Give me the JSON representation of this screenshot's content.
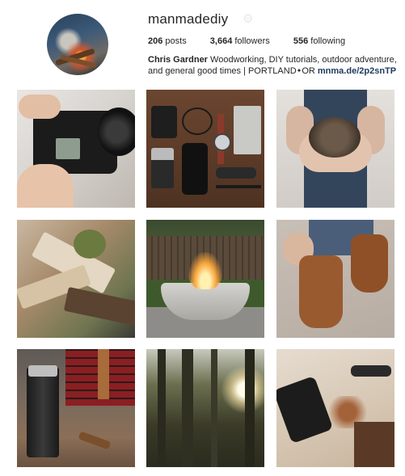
{
  "profile": {
    "username": "manmadediy",
    "stats": {
      "posts_count": "206",
      "posts_label": "posts",
      "followers_count": "3,664",
      "followers_label": "followers",
      "following_count": "556",
      "following_label": "following"
    },
    "bio": {
      "name": "Chris Gardner",
      "text": "Woodworking, DIY tutorials, outdoor adventure, and general good times | PORTLAND",
      "star": "✦",
      "or": "OR",
      "link": "mnma.de/2p2snTP"
    }
  },
  "posts": [
    {
      "subject": "camera"
    },
    {
      "subject": "everyday-carry flat lay"
    },
    {
      "subject": "hedgehog in hands"
    },
    {
      "subject": "split firewood"
    },
    {
      "subject": "fire bowl"
    },
    {
      "subject": "lacing boots"
    },
    {
      "subject": "stanley flask and blanket"
    },
    {
      "subject": "forest at sunset"
    },
    {
      "subject": "hand plane and wood shavings"
    }
  ],
  "colors": {
    "text": "#262626",
    "link": "#1e3a5f",
    "background": "#ffffff"
  }
}
